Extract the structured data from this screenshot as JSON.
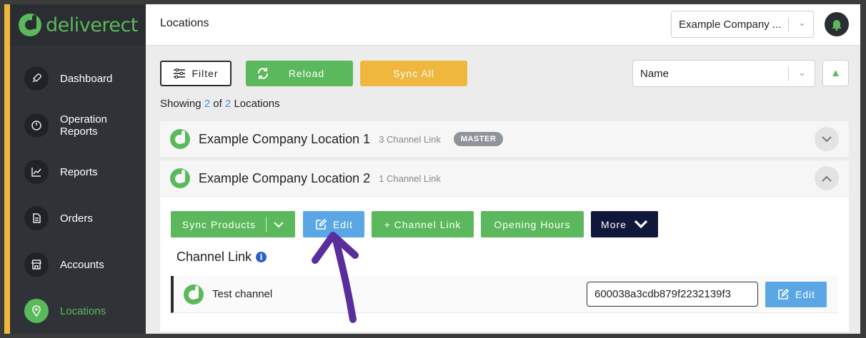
{
  "brand": {
    "name": "deliverect",
    "color": "#5cb85c"
  },
  "sidebar": {
    "items": [
      {
        "label": "Dashboard",
        "icon": "rocket-icon",
        "active": false
      },
      {
        "label": "Operation\nReports",
        "icon": "gauge-icon",
        "active": false
      },
      {
        "label": "Reports",
        "icon": "chart-icon",
        "active": false
      },
      {
        "label": "Orders",
        "icon": "document-icon",
        "active": false
      },
      {
        "label": "Accounts",
        "icon": "store-icon",
        "active": false
      },
      {
        "label": "Locations",
        "icon": "map-pin-icon",
        "active": true
      }
    ]
  },
  "header": {
    "title": "Locations",
    "company_select": "Example Company ...",
    "bell_icon": "bell-icon"
  },
  "toolbar": {
    "filter_label": "Filter",
    "reload_label": "Reload",
    "sync_all_label": "Sync All",
    "sort_select": "Name",
    "sort_direction_icon": "triangle-up-icon"
  },
  "summary": {
    "prefix": "Showing",
    "shown": "2",
    "of": "of",
    "total": "2",
    "suffix": "Locations"
  },
  "locations": [
    {
      "name": "Example Company Location 1",
      "channel_links": "3 Channel Link",
      "badge": "MASTER",
      "expanded": false
    },
    {
      "name": "Example Company Location 2",
      "channel_links": "1 Channel Link",
      "badge": "",
      "expanded": true
    }
  ],
  "location_actions": {
    "sync_products": "Sync Products",
    "edit": "Edit",
    "channel_link": "+ Channel Link",
    "opening_hours": "Opening Hours",
    "more": "More"
  },
  "channel_section": {
    "title": "Channel Link",
    "channels": [
      {
        "name": "Test channel",
        "id": "600038a3cdb879f2232139f3",
        "edit_label": "Edit"
      }
    ]
  },
  "colors": {
    "accent_green": "#5cb85c",
    "accent_yellow": "#f0b73e",
    "accent_blue": "#5ba7e6",
    "dark_navy": "#11173a",
    "annotation_arrow": "#5a2d9c"
  }
}
